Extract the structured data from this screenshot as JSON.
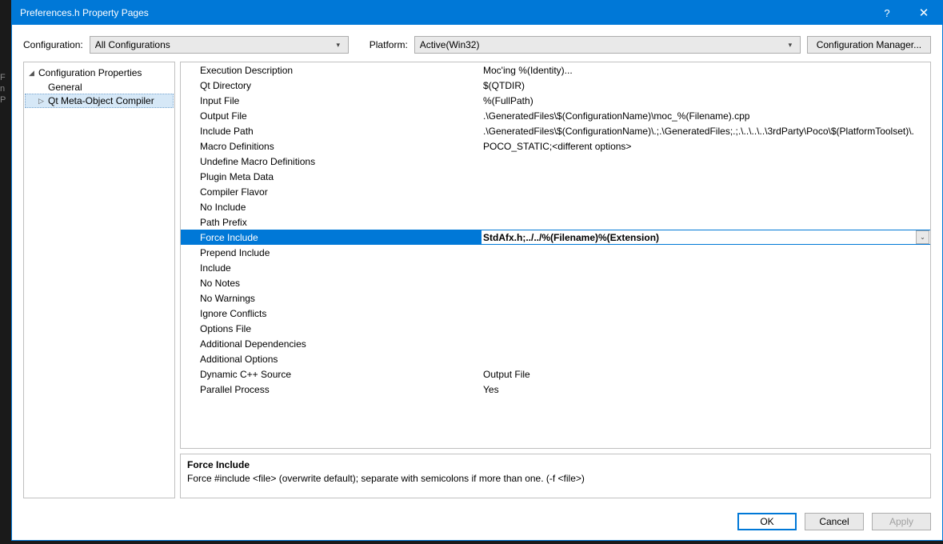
{
  "titlebar": {
    "title": "Preferences.h Property Pages",
    "help": "?",
    "close": "✕"
  },
  "toolbar": {
    "configuration_label": "Configuration:",
    "configuration_value": "All Configurations",
    "platform_label": "Platform:",
    "platform_value": "Active(Win32)",
    "cfg_mgr_label": "Configuration Manager..."
  },
  "tree": {
    "root": "Configuration Properties",
    "general": "General",
    "qtmoc": "Qt Meta-Object Compiler"
  },
  "properties": [
    {
      "label": "Execution Description",
      "value": "Moc'ing %(Identity)..."
    },
    {
      "label": "Qt Directory",
      "value": "$(QTDIR)"
    },
    {
      "label": "Input File",
      "value": "%(FullPath)"
    },
    {
      "label": "Output File",
      "value": ".\\GeneratedFiles\\$(ConfigurationName)\\moc_%(Filename).cpp"
    },
    {
      "label": "Include Path",
      "value": ".\\GeneratedFiles\\$(ConfigurationName)\\.;.\\GeneratedFiles;.;.\\..\\..\\..\\3rdParty\\Poco\\$(PlatformToolset)\\."
    },
    {
      "label": "Macro Definitions",
      "value": "POCO_STATIC;<different options>"
    },
    {
      "label": "Undefine Macro Definitions",
      "value": ""
    },
    {
      "label": "Plugin Meta Data",
      "value": ""
    },
    {
      "label": "Compiler Flavor",
      "value": ""
    },
    {
      "label": "No Include",
      "value": ""
    },
    {
      "label": "Path Prefix",
      "value": ""
    },
    {
      "label": "Force Include",
      "value": "StdAfx.h;../../%(Filename)%(Extension)",
      "selected": true
    },
    {
      "label": "Prepend Include",
      "value": ""
    },
    {
      "label": "Include",
      "value": ""
    },
    {
      "label": "No Notes",
      "value": ""
    },
    {
      "label": "No Warnings",
      "value": ""
    },
    {
      "label": "Ignore Conflicts",
      "value": ""
    },
    {
      "label": "Options File",
      "value": ""
    },
    {
      "label": "Additional Dependencies",
      "value": ""
    },
    {
      "label": "Additional Options",
      "value": ""
    },
    {
      "label": "Dynamic C++ Source",
      "value": "Output File"
    },
    {
      "label": "Parallel Process",
      "value": "Yes"
    }
  ],
  "description": {
    "title": "Force Include",
    "text": "Force #include <file>  (overwrite default); separate with semicolons if more than one. (-f <file>)"
  },
  "buttons": {
    "ok": "OK",
    "cancel": "Cancel",
    "apply": "Apply"
  }
}
